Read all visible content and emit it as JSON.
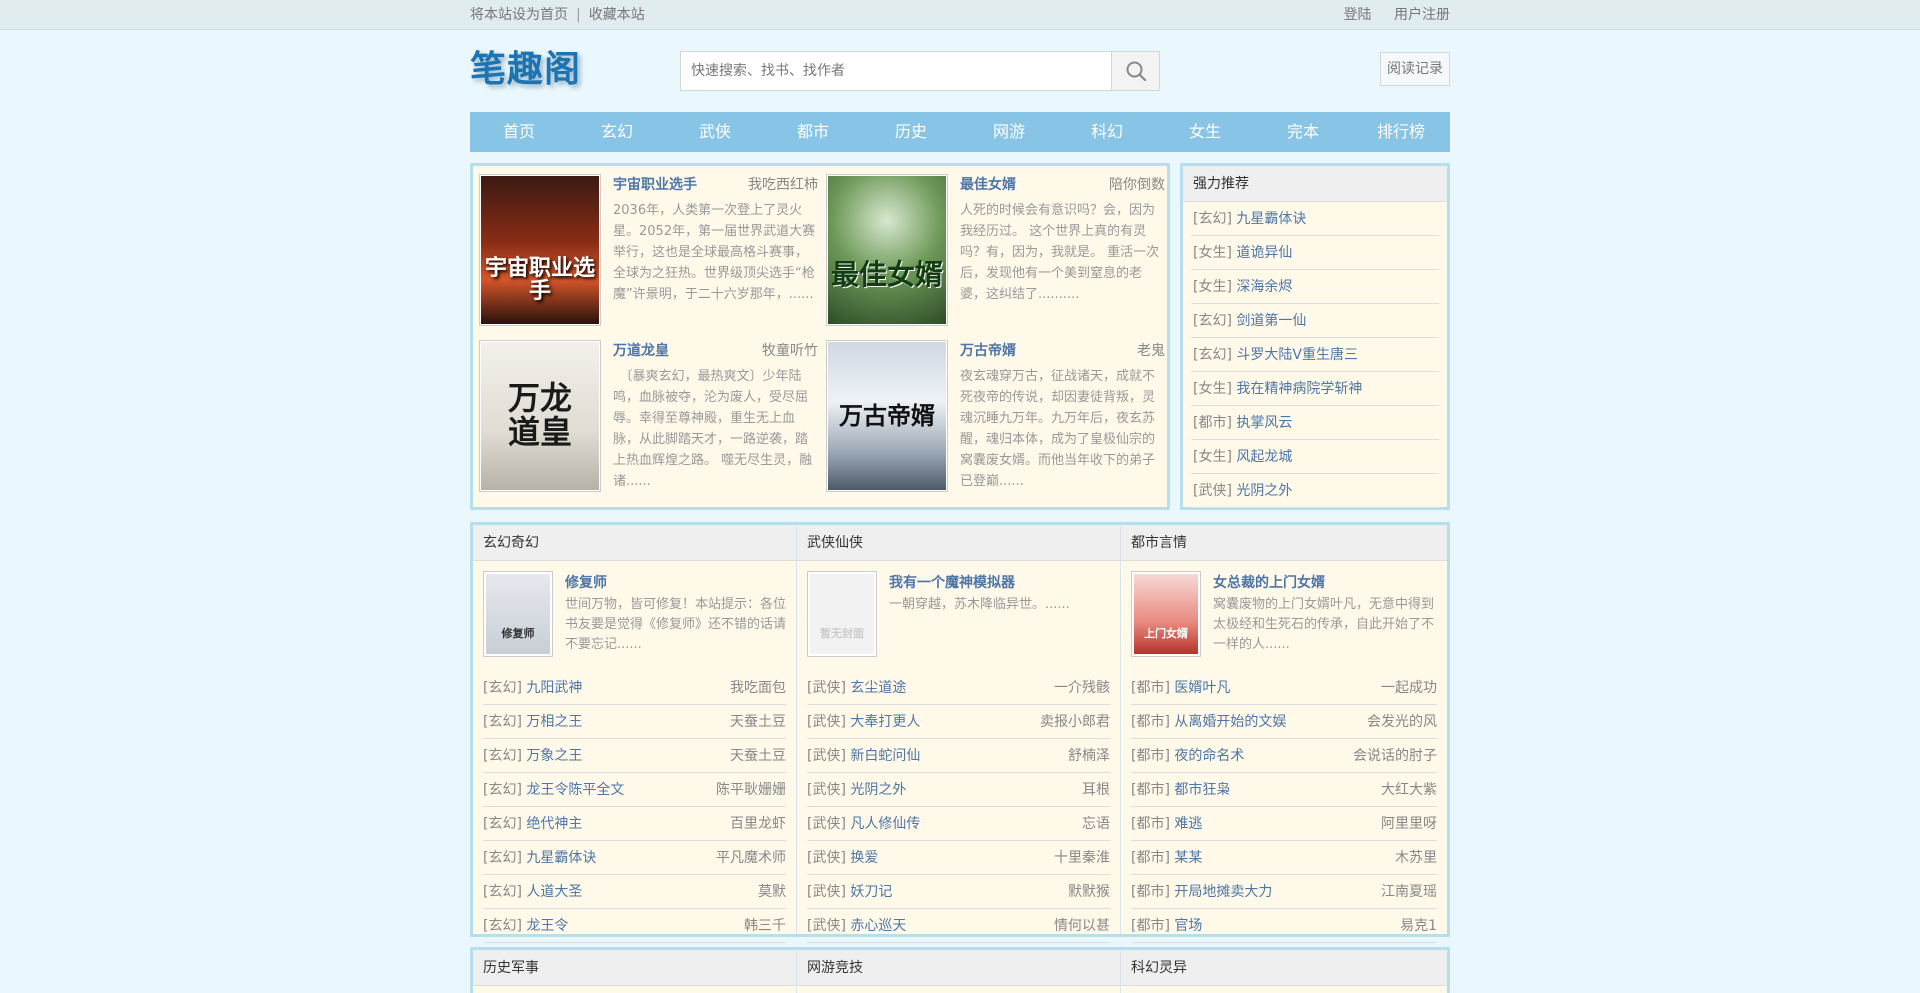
{
  "topbar": {
    "set_home": "将本站设为首页",
    "separator": "|",
    "bookmark": "收藏本站",
    "login": "登陆",
    "register": "用户注册"
  },
  "header": {
    "logo": "笔趣阁",
    "search_placeholder": "快速搜索、找书、找作者",
    "history": "阅读记录"
  },
  "nav": [
    "首页",
    "玄幻",
    "武侠",
    "都市",
    "历史",
    "网游",
    "科幻",
    "女生",
    "完本",
    "排行榜"
  ],
  "hot": [
    {
      "title": "宇宙职业选手",
      "author": "我吃西红柿",
      "desc": "2036年，人类第一次登上了灵火星。2052年，第一届世界武道大赛举行，这也是全球最高格斗赛事，全球为之狂热。世界级顶尖选手“枪魔”许景明，于二十六岁那年，......",
      "cover_text": "宇宙职业选手"
    },
    {
      "title": "最佳女婿",
      "author": "陪你倒数",
      "desc": "人死的时候会有意识吗？会，因为我经历过。 这个世界上真的有灵吗？有，因为，我就是。 重活一次后，发现他有一个美到窒息的老婆，这纠结了..........",
      "cover_text": "最佳女婿"
    },
    {
      "title": "万道龙皇",
      "author": "牧童听竹",
      "desc": "　〔暴爽玄幻，最热爽文〕少年陆鸣，血脉被夺，沦为废人，受尽屈辱。幸得至尊神殿，重生无上血脉，从此脚踏天才，一路逆袭，踏上热血辉煌之路。 噬无尽生灵，融诸......",
      "cover_text": "万龙道皇"
    },
    {
      "title": "万古帝婿",
      "author": "老鬼",
      "desc": "夜玄魂穿万古，征战诸天，成就不死夜帝的传说，却因妻徒背叛，灵魂沉睡九万年。九万年后，夜玄苏醒，魂归本体，成为了皇极仙宗的窝囊废女婿。而他当年收下的弟子已登巅......",
      "cover_text": "万古帝婿"
    }
  ],
  "recommend": {
    "title": "强力推荐",
    "items": [
      {
        "cat": "[玄幻]",
        "name": "九星霸体诀"
      },
      {
        "cat": "[女生]",
        "name": "道诡异仙"
      },
      {
        "cat": "[女生]",
        "name": "深海余烬"
      },
      {
        "cat": "[玄幻]",
        "name": "剑道第一仙"
      },
      {
        "cat": "[玄幻]",
        "name": "斗罗大陆V重生唐三"
      },
      {
        "cat": "[女生]",
        "name": "我在精神病院学斩神"
      },
      {
        "cat": "[都市]",
        "name": "执掌风云"
      },
      {
        "cat": "[女生]",
        "name": "风起龙城"
      },
      {
        "cat": "[武侠]",
        "name": "光阴之外"
      }
    ]
  },
  "categories": [
    {
      "title": "玄幻奇幻",
      "feature": {
        "title": "修复师",
        "desc": "世间万物，皆可修复！本站提示：各位书友要是觉得《修复师》还不错的话请不要忘记......",
        "cover_text": "修复师"
      },
      "rows": [
        {
          "cat": "[玄幻]",
          "name": "九阳武神",
          "author": "我吃面包"
        },
        {
          "cat": "[玄幻]",
          "name": "万相之王",
          "author": "天蚕土豆"
        },
        {
          "cat": "[玄幻]",
          "name": "万象之王",
          "author": "天蚕土豆"
        },
        {
          "cat": "[玄幻]",
          "name": "龙王令陈平全文",
          "author": "陈平耿姗姗"
        },
        {
          "cat": "[玄幻]",
          "name": "绝代神主",
          "author": "百里龙虾"
        },
        {
          "cat": "[玄幻]",
          "name": "九星霸体诀",
          "author": "平凡魔术师"
        },
        {
          "cat": "[玄幻]",
          "name": "人道大圣",
          "author": "莫默"
        },
        {
          "cat": "[玄幻]",
          "name": "龙王令",
          "author": "韩三千"
        }
      ]
    },
    {
      "title": "武侠仙侠",
      "feature": {
        "title": "我有一个魔神模拟器",
        "desc": "一朝穿越，苏木降临异世。......",
        "cover_text": "暂无封面"
      },
      "rows": [
        {
          "cat": "[武侠]",
          "name": "玄尘道途",
          "author": "一介残骸"
        },
        {
          "cat": "[武侠]",
          "name": "大奉打更人",
          "author": "卖报小郎君"
        },
        {
          "cat": "[武侠]",
          "name": "新白蛇问仙",
          "author": "舒楠泽"
        },
        {
          "cat": "[武侠]",
          "name": "光阴之外",
          "author": "耳根"
        },
        {
          "cat": "[武侠]",
          "name": "凡人修仙传",
          "author": "忘语"
        },
        {
          "cat": "[武侠]",
          "name": "换爱",
          "author": "十里秦淮"
        },
        {
          "cat": "[武侠]",
          "name": "妖刀记",
          "author": "默默猴"
        },
        {
          "cat": "[武侠]",
          "name": "赤心巡天",
          "author": "情何以甚"
        }
      ]
    },
    {
      "title": "都市言情",
      "feature": {
        "title": "女总裁的上门女婿",
        "desc": "窝囊废物的上门女婿叶凡，无意中得到太极经和生死石的传承，自此开始了不一样的人......",
        "cover_text": "上门女婿"
      },
      "rows": [
        {
          "cat": "[都市]",
          "name": "医婿叶凡",
          "author": "一起成功"
        },
        {
          "cat": "[都市]",
          "name": "从离婚开始的文娱",
          "author": "会发光的风"
        },
        {
          "cat": "[都市]",
          "name": "夜的命名术",
          "author": "会说话的肘子"
        },
        {
          "cat": "[都市]",
          "name": "都市狂枭",
          "author": "大红大紫"
        },
        {
          "cat": "[都市]",
          "name": "难逃",
          "author": "阿里里呀"
        },
        {
          "cat": "[都市]",
          "name": "某某",
          "author": "木苏里"
        },
        {
          "cat": "[都市]",
          "name": "开局地摊卖大力",
          "author": "江南夏瑶"
        },
        {
          "cat": "[都市]",
          "name": "官场",
          "author": "易克1"
        }
      ]
    }
  ],
  "categories2": [
    "历史军事",
    "网游竞技",
    "科幻灵异"
  ],
  "colors": {
    "nav_bg": "#88c4e5",
    "link": "#4e76a6",
    "panel_bg": "#fff9ea",
    "border": "#b6dfee"
  }
}
